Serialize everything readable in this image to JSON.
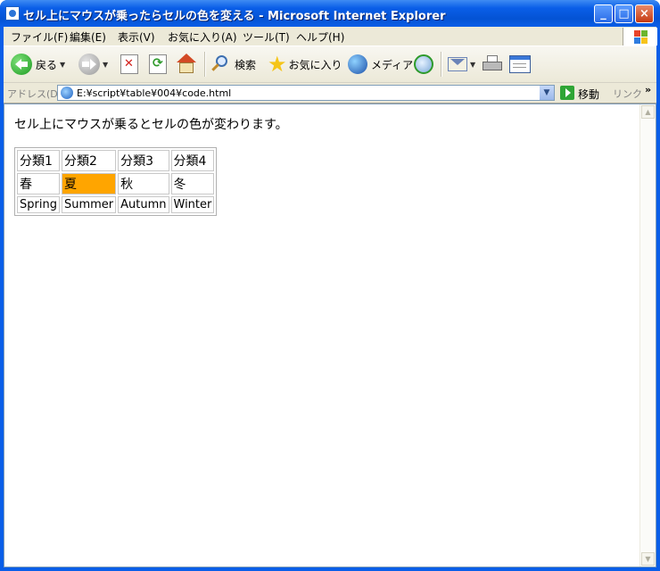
{
  "window": {
    "title": "セル上にマウスが乗ったらセルの色を変える - Microsoft Internet Explorer",
    "controls": {
      "minimize": "_",
      "maximize": "□",
      "close": "×"
    }
  },
  "menu": [
    "ファイル(F)",
    "編集(E)",
    "表示(V)",
    "お気に入り(A)",
    "ツール(T)",
    "ヘルプ(H)"
  ],
  "toolbar": {
    "back": "戻る",
    "search": "検索",
    "favorites": "お気に入り",
    "media": "メディア"
  },
  "address": {
    "label": "アドレス(D)",
    "url": "E:¥script¥table¥004¥code.html",
    "go": "移動",
    "links": "リンク",
    "more": "»"
  },
  "page": {
    "intro": "セル上にマウスが乗るとセルの色が変わります。",
    "table": {
      "headers": [
        "分類1",
        "分類2",
        "分類3",
        "分類4"
      ],
      "row_jp": [
        "春",
        "夏",
        "秋",
        "冬"
      ],
      "row_en": [
        "Spring",
        "Summer",
        "Autumn",
        "Winter"
      ],
      "highlight_color": "#FFA500"
    }
  }
}
